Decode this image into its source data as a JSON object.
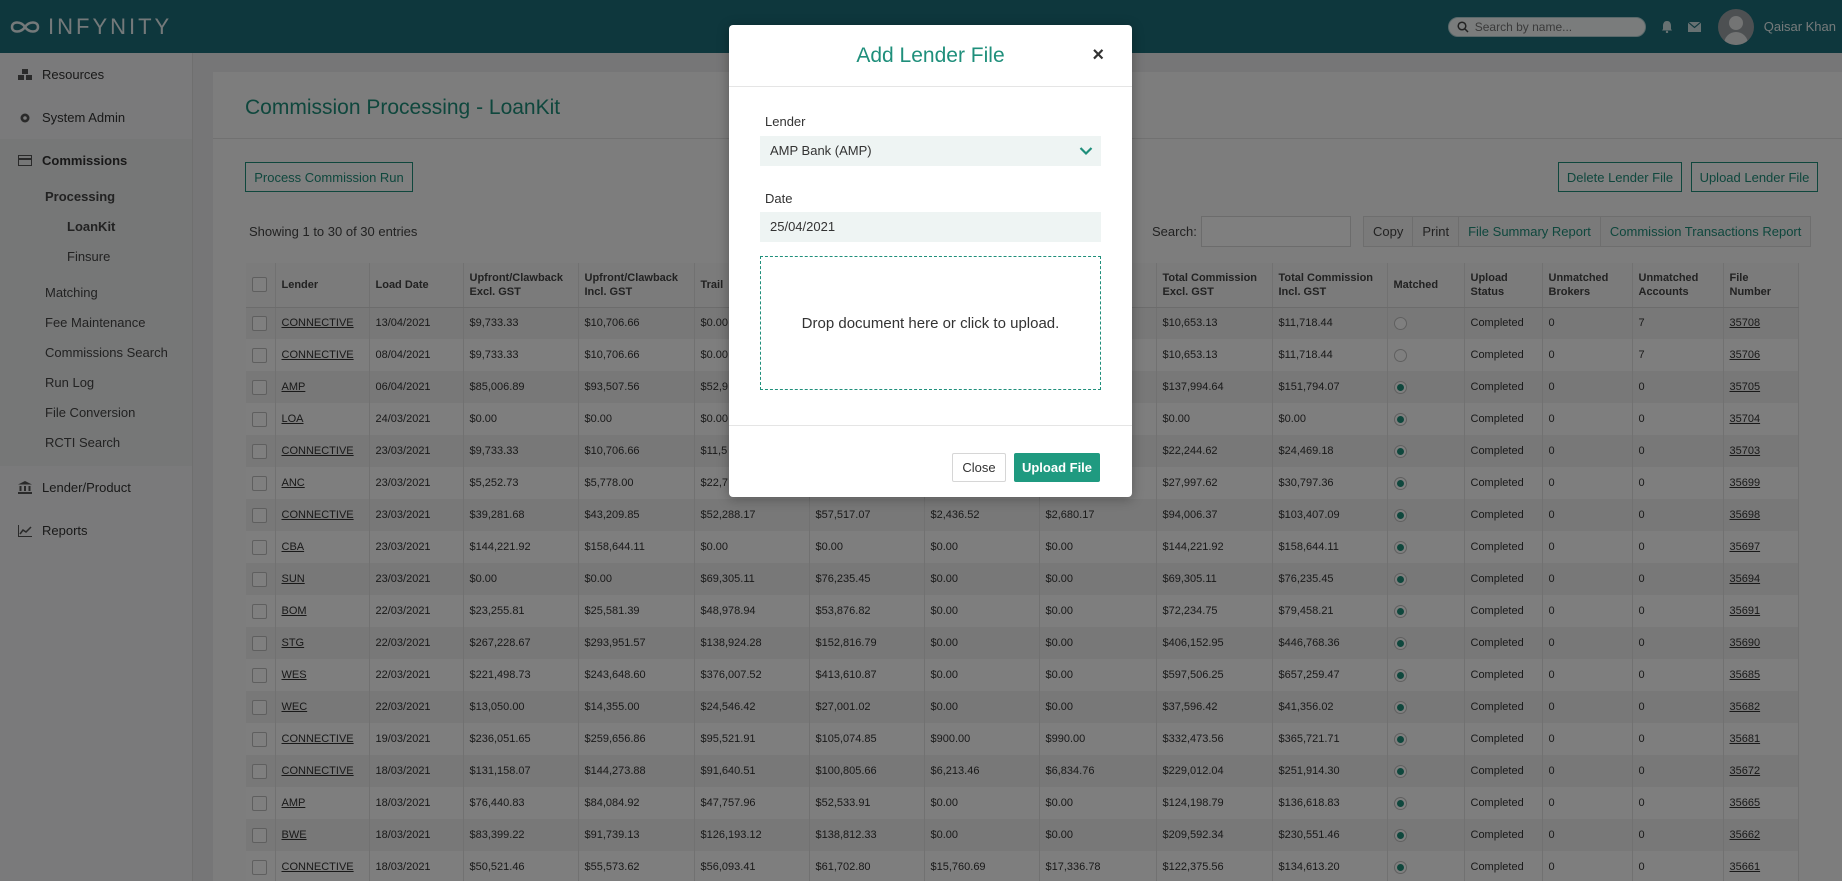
{
  "app": {
    "brand": "INFYNITY"
  },
  "header": {
    "search_placeholder": "Search by name...",
    "user_name": "Qaisar Khan"
  },
  "sidebar": {
    "resources": "Resources",
    "system_admin": "System Admin",
    "commissions": "Commissions",
    "processing": "Processing",
    "loankit": "LoanKit",
    "finsure": "Finsure",
    "matching": "Matching",
    "fee_maintenance": "Fee Maintenance",
    "commissions_search": "Commissions Search",
    "run_log": "Run Log",
    "file_conversion": "File Conversion",
    "rcti_search": "RCTI Search",
    "lender_product": "Lender/Product",
    "reports": "Reports"
  },
  "page": {
    "title": "Commission Processing - LoanKit",
    "process_btn": "Process Commission Run",
    "delete_btn": "Delete Lender File",
    "upload_btn": "Upload Lender File",
    "showing": "Showing 1 to 30 of 30 entries",
    "search_label": "Search:",
    "tools": {
      "copy": "Copy",
      "print": "Print",
      "file_summary": "File Summary Report",
      "commission_tx": "Commission Transactions Report"
    }
  },
  "table": {
    "headers": {
      "lender": "Lender",
      "load_date": "Load Date",
      "upfront_excl_1": "Upfront/Clawback",
      "upfront_excl_2": "Excl. GST",
      "upfront_incl_1": "Upfront/Clawback",
      "upfront_incl_2": "Incl. GST",
      "trail": "Trail",
      "total_excl_1": "Total Commission",
      "total_excl_2": "Excl. GST",
      "total_incl_1": "Total Commission",
      "total_incl_2": "Incl. GST",
      "matched": "Matched",
      "upload_1": "Upload",
      "upload_2": "Status",
      "unb_1": "Unmatched",
      "unb_2": "Brokers",
      "una_1": "Unmatched",
      "una_2": "Accounts",
      "file_number": "File Number"
    },
    "rows": [
      {
        "lender": "CONNECTIVE",
        "date": "13/04/2021",
        "ue": "$9,733.33",
        "ui": "$10,706.66",
        "te": "$0.00",
        "ti": "",
        "oe": "",
        "oi": "",
        "tce": "$10,653.13",
        "tci": "$11,718.44",
        "matched": false,
        "status": "Completed",
        "ub": "0",
        "ua": "7",
        "file": "35708"
      },
      {
        "lender": "CONNECTIVE",
        "date": "08/04/2021",
        "ue": "$9,733.33",
        "ui": "$10,706.66",
        "te": "$0.00",
        "ti": "",
        "oe": "",
        "oi": "",
        "tce": "$10,653.13",
        "tci": "$11,718.44",
        "matched": false,
        "status": "Completed",
        "ub": "0",
        "ua": "7",
        "file": "35706"
      },
      {
        "lender": "AMP",
        "date": "06/04/2021",
        "ue": "$85,006.89",
        "ui": "$93,507.56",
        "te": "$52,9",
        "ti": "",
        "oe": "",
        "oi": "",
        "tce": "$137,994.64",
        "tci": "$151,794.07",
        "matched": true,
        "status": "Completed",
        "ub": "0",
        "ua": "0",
        "file": "35705"
      },
      {
        "lender": "LOA",
        "date": "24/03/2021",
        "ue": "$0.00",
        "ui": "$0.00",
        "te": "$0.00",
        "ti": "",
        "oe": "",
        "oi": "",
        "tce": "$0.00",
        "tci": "$0.00",
        "matched": true,
        "status": "Completed",
        "ub": "0",
        "ua": "0",
        "file": "35704"
      },
      {
        "lender": "CONNECTIVE",
        "date": "23/03/2021",
        "ue": "$9,733.33",
        "ui": "$10,706.66",
        "te": "$11,5",
        "ti": "",
        "oe": "",
        "oi": "",
        "tce": "$22,244.62",
        "tci": "$24,469.18",
        "matched": true,
        "status": "Completed",
        "ub": "0",
        "ua": "0",
        "file": "35703"
      },
      {
        "lender": "ANC",
        "date": "23/03/2021",
        "ue": "$5,252.73",
        "ui": "$5,778.00",
        "te": "$22,7",
        "ti": "",
        "oe": "",
        "oi": "",
        "tce": "$27,997.62",
        "tci": "$30,797.36",
        "matched": true,
        "status": "Completed",
        "ub": "0",
        "ua": "0",
        "file": "35699"
      },
      {
        "lender": "CONNECTIVE",
        "date": "23/03/2021",
        "ue": "$39,281.68",
        "ui": "$43,209.85",
        "te": "$52,288.17",
        "ti": "$57,517.07",
        "oe": "$2,436.52",
        "oi": "$2,680.17",
        "tce": "$94,006.37",
        "tci": "$103,407.09",
        "matched": true,
        "status": "Completed",
        "ub": "0",
        "ua": "0",
        "file": "35698"
      },
      {
        "lender": "CBA",
        "date": "23/03/2021",
        "ue": "$144,221.92",
        "ui": "$158,644.11",
        "te": "$0.00",
        "ti": "$0.00",
        "oe": "$0.00",
        "oi": "$0.00",
        "tce": "$144,221.92",
        "tci": "$158,644.11",
        "matched": true,
        "status": "Completed",
        "ub": "0",
        "ua": "0",
        "file": "35697"
      },
      {
        "lender": "SUN",
        "date": "23/03/2021",
        "ue": "$0.00",
        "ui": "$0.00",
        "te": "$69,305.11",
        "ti": "$76,235.45",
        "oe": "$0.00",
        "oi": "$0.00",
        "tce": "$69,305.11",
        "tci": "$76,235.45",
        "matched": true,
        "status": "Completed",
        "ub": "0",
        "ua": "0",
        "file": "35694"
      },
      {
        "lender": "BOM",
        "date": "22/03/2021",
        "ue": "$23,255.81",
        "ui": "$25,581.39",
        "te": "$48,978.94",
        "ti": "$53,876.82",
        "oe": "$0.00",
        "oi": "$0.00",
        "tce": "$72,234.75",
        "tci": "$79,458.21",
        "matched": true,
        "status": "Completed",
        "ub": "0",
        "ua": "0",
        "file": "35691"
      },
      {
        "lender": "STG",
        "date": "22/03/2021",
        "ue": "$267,228.67",
        "ui": "$293,951.57",
        "te": "$138,924.28",
        "ti": "$152,816.79",
        "oe": "$0.00",
        "oi": "$0.00",
        "tce": "$406,152.95",
        "tci": "$446,768.36",
        "matched": true,
        "status": "Completed",
        "ub": "0",
        "ua": "0",
        "file": "35690"
      },
      {
        "lender": "WES",
        "date": "22/03/2021",
        "ue": "$221,498.73",
        "ui": "$243,648.60",
        "te": "$376,007.52",
        "ti": "$413,610.87",
        "oe": "$0.00",
        "oi": "$0.00",
        "tce": "$597,506.25",
        "tci": "$657,259.47",
        "matched": true,
        "status": "Completed",
        "ub": "0",
        "ua": "0",
        "file": "35685"
      },
      {
        "lender": "WEC",
        "date": "22/03/2021",
        "ue": "$13,050.00",
        "ui": "$14,355.00",
        "te": "$24,546.42",
        "ti": "$27,001.02",
        "oe": "$0.00",
        "oi": "$0.00",
        "tce": "$37,596.42",
        "tci": "$41,356.02",
        "matched": true,
        "status": "Completed",
        "ub": "0",
        "ua": "0",
        "file": "35682"
      },
      {
        "lender": "CONNECTIVE",
        "date": "19/03/2021",
        "ue": "$236,051.65",
        "ui": "$259,656.86",
        "te": "$95,521.91",
        "ti": "$105,074.85",
        "oe": "$900.00",
        "oi": "$990.00",
        "tce": "$332,473.56",
        "tci": "$365,721.71",
        "matched": true,
        "status": "Completed",
        "ub": "0",
        "ua": "0",
        "file": "35681"
      },
      {
        "lender": "CONNECTIVE",
        "date": "18/03/2021",
        "ue": "$131,158.07",
        "ui": "$144,273.88",
        "te": "$91,640.51",
        "ti": "$100,805.66",
        "oe": "$6,213.46",
        "oi": "$6,834.76",
        "tce": "$229,012.04",
        "tci": "$251,914.30",
        "matched": true,
        "status": "Completed",
        "ub": "0",
        "ua": "0",
        "file": "35672"
      },
      {
        "lender": "AMP",
        "date": "18/03/2021",
        "ue": "$76,440.83",
        "ui": "$84,084.92",
        "te": "$47,757.96",
        "ti": "$52,533.91",
        "oe": "$0.00",
        "oi": "$0.00",
        "tce": "$124,198.79",
        "tci": "$136,618.83",
        "matched": true,
        "status": "Completed",
        "ub": "0",
        "ua": "0",
        "file": "35665"
      },
      {
        "lender": "BWE",
        "date": "18/03/2021",
        "ue": "$83,399.22",
        "ui": "$91,739.13",
        "te": "$126,193.12",
        "ti": "$138,812.33",
        "oe": "$0.00",
        "oi": "$0.00",
        "tce": "$209,592.34",
        "tci": "$230,551.46",
        "matched": true,
        "status": "Completed",
        "ub": "0",
        "ua": "0",
        "file": "35662"
      },
      {
        "lender": "CONNECTIVE",
        "date": "18/03/2021",
        "ue": "$50,521.46",
        "ui": "$55,573.62",
        "te": "$56,093.41",
        "ti": "$61,702.80",
        "oe": "$15,760.69",
        "oi": "$17,336.78",
        "tce": "$122,375.56",
        "tci": "$134,613.20",
        "matched": true,
        "status": "Completed",
        "ub": "0",
        "ua": "0",
        "file": "35661"
      }
    ]
  },
  "modal": {
    "title": "Add Lender File",
    "close_symbol": "×",
    "lender_label": "Lender",
    "lender_value": "AMP Bank (AMP)",
    "date_label": "Date",
    "date_value": "25/04/2021",
    "dropzone_text": "Drop document here or click to upload.",
    "close_btn": "Close",
    "upload_btn": "Upload File"
  }
}
